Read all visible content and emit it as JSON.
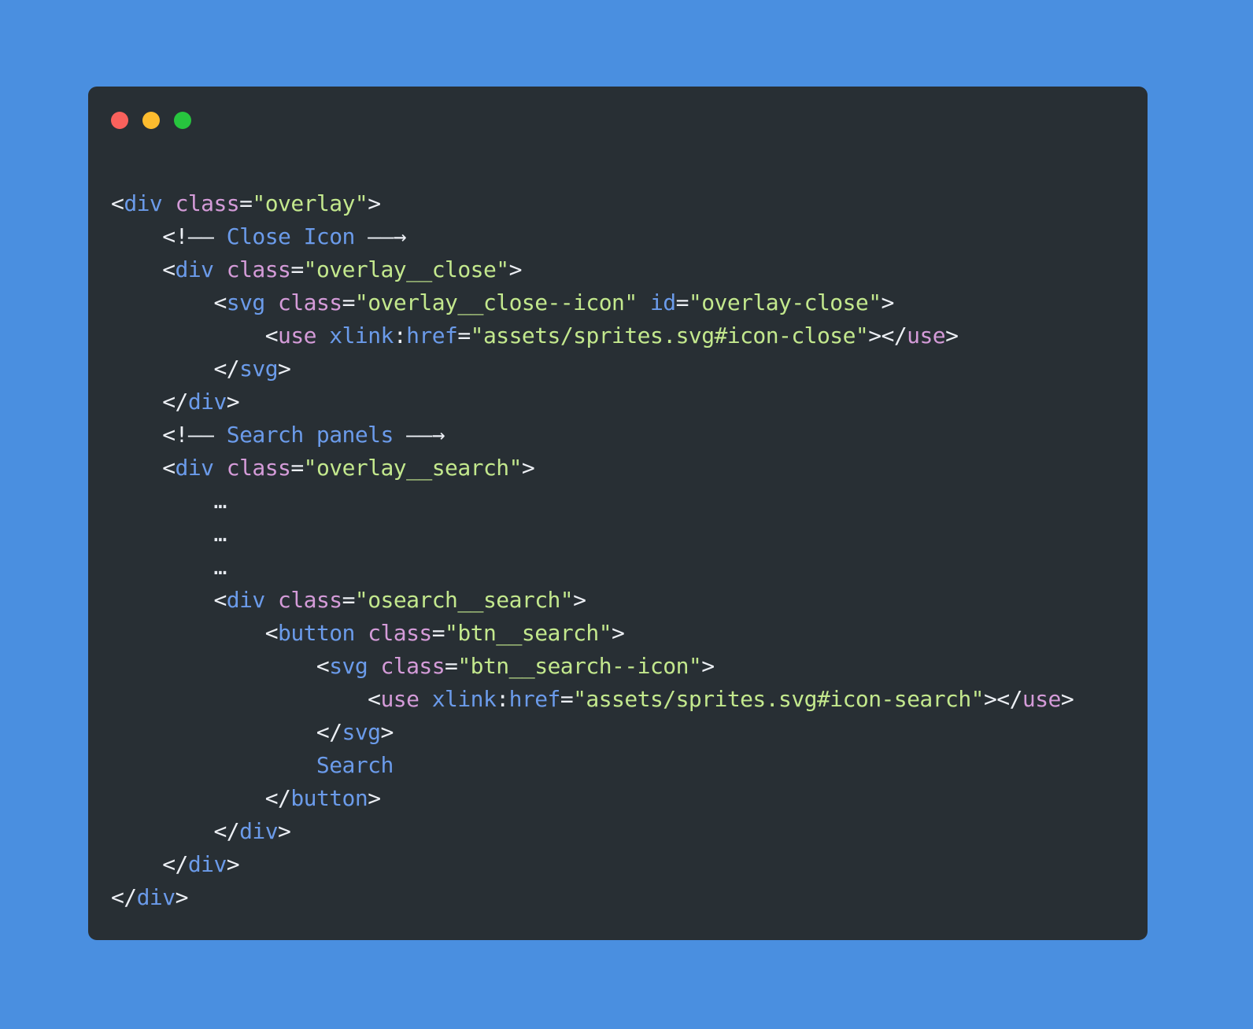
{
  "window": {
    "background_color": "#4a8fe0",
    "panel_color": "#282f34",
    "traffic_lights": [
      {
        "name": "close",
        "color": "#f9615c"
      },
      {
        "name": "minimize",
        "color": "#fdbc2e"
      },
      {
        "name": "maximize",
        "color": "#27c53e"
      }
    ]
  },
  "theme": {
    "punctuation": "#eceff4",
    "tag": "#6b9bea",
    "tag_alt": "#d49bd8",
    "attribute": "#d49bd8",
    "attribute_alt": "#6b9bea",
    "string": "#c3e88d",
    "comment": "#6b9bea",
    "text": "#6b9bea"
  },
  "code": {
    "language": "html",
    "indent_size": 4,
    "plain_text": "<div class=\"overlay\">\n    <!-- Close Icon -->\n    <div class=\"overlay__close\">\n        <svg class=\"overlay__close--icon\" id=\"overlay-close\">\n            <use xlink:href=\"assets/sprites.svg#icon-close\"></use>\n        </svg>\n    </div>\n    <!-- Search panels -->\n    <div class=\"overlay__search\">\n        ...\n        ...\n        ...\n        <div class=\"osearch__search\">\n            <button class=\"btn__search\">\n                <svg class=\"btn__search--icon\">\n                    <use xlink:href=\"assets/sprites.svg#icon-search\"></use>\n                </svg>\n                Search\n            </button>\n        </div>\n    </div>\n</div>",
    "lines": [
      {
        "indent": 0,
        "tokens": [
          {
            "t": "<",
            "c": "punc"
          },
          {
            "t": "div",
            "c": "tag"
          },
          {
            "t": " ",
            "c": "punc"
          },
          {
            "t": "class",
            "c": "attr"
          },
          {
            "t": "=",
            "c": "punc"
          },
          {
            "t": "\"overlay\"",
            "c": "str"
          },
          {
            "t": ">",
            "c": "punc"
          }
        ]
      },
      {
        "indent": 1,
        "tokens": [
          {
            "t": "<!——",
            "c": "cmtp"
          },
          {
            "t": " ",
            "c": "punc"
          },
          {
            "t": "Close Icon",
            "c": "cmt"
          },
          {
            "t": " ",
            "c": "punc"
          },
          {
            "t": "——→",
            "c": "cmtp"
          }
        ]
      },
      {
        "indent": 1,
        "tokens": [
          {
            "t": "<",
            "c": "punc"
          },
          {
            "t": "div",
            "c": "tag"
          },
          {
            "t": " ",
            "c": "punc"
          },
          {
            "t": "class",
            "c": "attr"
          },
          {
            "t": "=",
            "c": "punc"
          },
          {
            "t": "\"overlay__close\"",
            "c": "str"
          },
          {
            "t": ">",
            "c": "punc"
          }
        ]
      },
      {
        "indent": 2,
        "tokens": [
          {
            "t": "<",
            "c": "punc"
          },
          {
            "t": "svg",
            "c": "tag"
          },
          {
            "t": " ",
            "c": "punc"
          },
          {
            "t": "class",
            "c": "attr"
          },
          {
            "t": "=",
            "c": "punc"
          },
          {
            "t": "\"overlay__close--icon\"",
            "c": "str"
          },
          {
            "t": " ",
            "c": "punc"
          },
          {
            "t": "id",
            "c": "attr2"
          },
          {
            "t": "=",
            "c": "punc"
          },
          {
            "t": "\"overlay-close\"",
            "c": "str"
          },
          {
            "t": ">",
            "c": "punc"
          }
        ]
      },
      {
        "indent": 3,
        "tokens": [
          {
            "t": "<",
            "c": "punc"
          },
          {
            "t": "use",
            "c": "tag2"
          },
          {
            "t": " ",
            "c": "punc"
          },
          {
            "t": "xlink",
            "c": "attr2"
          },
          {
            "t": ":",
            "c": "punc"
          },
          {
            "t": "href",
            "c": "attr2"
          },
          {
            "t": "=",
            "c": "punc"
          },
          {
            "t": "\"assets/sprites.svg#icon-close\"",
            "c": "str"
          },
          {
            "t": "></",
            "c": "punc"
          },
          {
            "t": "use",
            "c": "tag2"
          },
          {
            "t": ">",
            "c": "punc"
          }
        ]
      },
      {
        "indent": 2,
        "tokens": [
          {
            "t": "</",
            "c": "punc"
          },
          {
            "t": "svg",
            "c": "tag"
          },
          {
            "t": ">",
            "c": "punc"
          }
        ]
      },
      {
        "indent": 1,
        "tokens": [
          {
            "t": "</",
            "c": "punc"
          },
          {
            "t": "div",
            "c": "tag"
          },
          {
            "t": ">",
            "c": "punc"
          }
        ]
      },
      {
        "indent": 1,
        "tokens": [
          {
            "t": "<!——",
            "c": "cmtp"
          },
          {
            "t": " ",
            "c": "punc"
          },
          {
            "t": "Search panels",
            "c": "cmt"
          },
          {
            "t": " ",
            "c": "punc"
          },
          {
            "t": "——→",
            "c": "cmtp"
          }
        ]
      },
      {
        "indent": 1,
        "tokens": [
          {
            "t": "<",
            "c": "punc"
          },
          {
            "t": "div",
            "c": "tag"
          },
          {
            "t": " ",
            "c": "punc"
          },
          {
            "t": "class",
            "c": "attr"
          },
          {
            "t": "=",
            "c": "punc"
          },
          {
            "t": "\"overlay__search\"",
            "c": "str"
          },
          {
            "t": ">",
            "c": "punc"
          }
        ]
      },
      {
        "indent": 2,
        "tokens": [
          {
            "t": "…",
            "c": "dots"
          }
        ]
      },
      {
        "indent": 2,
        "tokens": [
          {
            "t": "…",
            "c": "dots"
          }
        ]
      },
      {
        "indent": 2,
        "tokens": [
          {
            "t": "…",
            "c": "dots"
          }
        ]
      },
      {
        "indent": 2,
        "tokens": [
          {
            "t": "<",
            "c": "punc"
          },
          {
            "t": "div",
            "c": "tag"
          },
          {
            "t": " ",
            "c": "punc"
          },
          {
            "t": "class",
            "c": "attr"
          },
          {
            "t": "=",
            "c": "punc"
          },
          {
            "t": "\"osearch__search\"",
            "c": "str"
          },
          {
            "t": ">",
            "c": "punc"
          }
        ]
      },
      {
        "indent": 3,
        "tokens": [
          {
            "t": "<",
            "c": "punc"
          },
          {
            "t": "button",
            "c": "tag"
          },
          {
            "t": " ",
            "c": "punc"
          },
          {
            "t": "class",
            "c": "attr"
          },
          {
            "t": "=",
            "c": "punc"
          },
          {
            "t": "\"btn__search\"",
            "c": "str"
          },
          {
            "t": ">",
            "c": "punc"
          }
        ]
      },
      {
        "indent": 4,
        "tokens": [
          {
            "t": "<",
            "c": "punc"
          },
          {
            "t": "svg",
            "c": "tag"
          },
          {
            "t": " ",
            "c": "punc"
          },
          {
            "t": "class",
            "c": "attr"
          },
          {
            "t": "=",
            "c": "punc"
          },
          {
            "t": "\"btn__search--icon\"",
            "c": "str"
          },
          {
            "t": ">",
            "c": "punc"
          }
        ]
      },
      {
        "indent": 5,
        "tokens": [
          {
            "t": "<",
            "c": "punc"
          },
          {
            "t": "use",
            "c": "tag2"
          },
          {
            "t": " ",
            "c": "punc"
          },
          {
            "t": "xlink",
            "c": "attr2"
          },
          {
            "t": ":",
            "c": "punc"
          },
          {
            "t": "href",
            "c": "attr2"
          },
          {
            "t": "=",
            "c": "punc"
          },
          {
            "t": "\"assets/sprites.svg#icon-search\"",
            "c": "str"
          },
          {
            "t": "></",
            "c": "punc"
          },
          {
            "t": "use",
            "c": "tag2"
          },
          {
            "t": ">",
            "c": "punc"
          }
        ]
      },
      {
        "indent": 4,
        "tokens": [
          {
            "t": "</",
            "c": "punc"
          },
          {
            "t": "svg",
            "c": "tag"
          },
          {
            "t": ">",
            "c": "punc"
          }
        ]
      },
      {
        "indent": 4,
        "tokens": [
          {
            "t": "Search",
            "c": "text"
          }
        ]
      },
      {
        "indent": 3,
        "tokens": [
          {
            "t": "</",
            "c": "punc"
          },
          {
            "t": "button",
            "c": "tag"
          },
          {
            "t": ">",
            "c": "punc"
          }
        ]
      },
      {
        "indent": 2,
        "tokens": [
          {
            "t": "</",
            "c": "punc"
          },
          {
            "t": "div",
            "c": "tag"
          },
          {
            "t": ">",
            "c": "punc"
          }
        ]
      },
      {
        "indent": 1,
        "tokens": [
          {
            "t": "</",
            "c": "punc"
          },
          {
            "t": "div",
            "c": "tag"
          },
          {
            "t": ">",
            "c": "punc"
          }
        ]
      },
      {
        "indent": 0,
        "tokens": [
          {
            "t": "</",
            "c": "punc"
          },
          {
            "t": "div",
            "c": "tag"
          },
          {
            "t": ">",
            "c": "punc"
          }
        ]
      }
    ]
  }
}
